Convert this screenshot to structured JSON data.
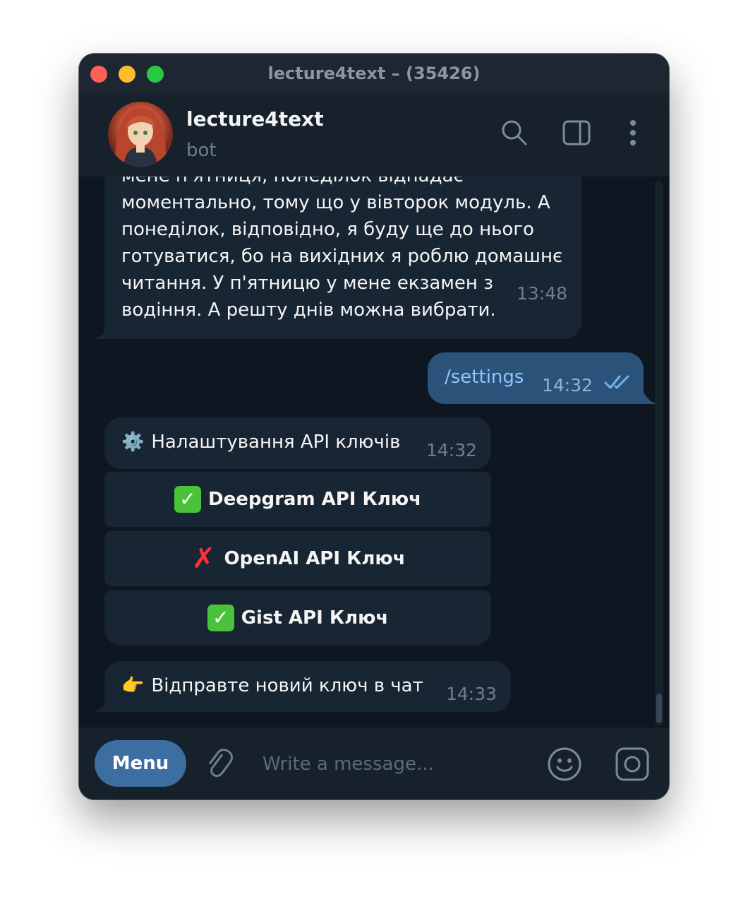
{
  "window": {
    "title": "lecture4text – (35426)"
  },
  "header": {
    "chat_name": "lecture4text",
    "status": "bot",
    "icons": [
      "search-icon",
      "sidebar-toggle-icon",
      "more-vertical-icon"
    ]
  },
  "messages": {
    "incoming_1": {
      "text": "мене п'ятниця, понеділок відпадає\nмоментально, тому що у вівторок модуль. А\nпонеділок, відповідно, я буду ще до нього\nготуватися, бо на вихідних я роблю домашнє\nчитання. У п'ятницю у мене екзамен з\nводіння. А решту днів можна вибрати.",
      "time": "13:48"
    },
    "outgoing_1": {
      "text": "/settings",
      "time": "14:32",
      "status_icon": "double-check-icon"
    },
    "settings_msg": {
      "emoji": "⚙️",
      "text": "Налаштування API ключів",
      "time": "14:32"
    },
    "keyboard": [
      {
        "mark": "✓",
        "label": "Deepgram API Ключ",
        "state": "set"
      },
      {
        "mark": "✗",
        "label": "OpenAI API Ключ",
        "state": "missing"
      },
      {
        "mark": "✓",
        "label": "Gist API Ключ",
        "state": "set"
      }
    ],
    "prompt_msg": {
      "emoji": "👉",
      "text": "Відправте новий ключ в чат",
      "time": "14:33"
    }
  },
  "composer": {
    "menu_label": "Menu",
    "placeholder": "Write a message...",
    "icons": [
      "attach-icon",
      "emoji-icon",
      "camera-icon"
    ]
  },
  "colors": {
    "window_bg": "#0e1621",
    "header_bg": "#17212b",
    "bubble_in": "#182533",
    "bubble_out": "#2b5278",
    "menu_button": "#3d6ea1",
    "muted_text": "#6d7f8f"
  }
}
